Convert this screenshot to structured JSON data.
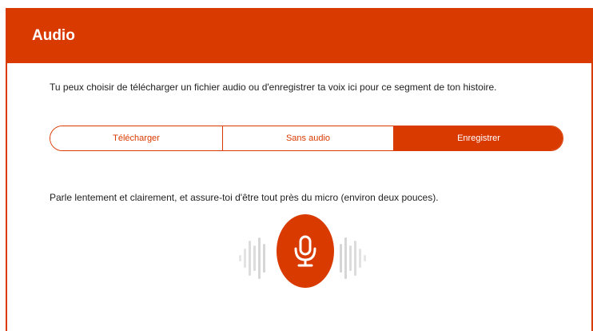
{
  "header": {
    "title": "Audio"
  },
  "intro_text": "Tu peux choisir de télécharger un fichier audio ou d'enregistrer ta voix ici pour ce segment de ton histoire.",
  "options": [
    {
      "label": "Télécharger",
      "selected": false
    },
    {
      "label": "Sans audio",
      "selected": false
    },
    {
      "label": "Enregistrer",
      "selected": true
    }
  ],
  "hint_text": "Parle lentement et clairement, et assure-toi d'être tout près du micro (environ deux pouces).",
  "record": {
    "icon": "microphone-icon"
  },
  "colors": {
    "accent": "#d93a00",
    "wave": "#e2e2e2",
    "text": "#222222"
  }
}
